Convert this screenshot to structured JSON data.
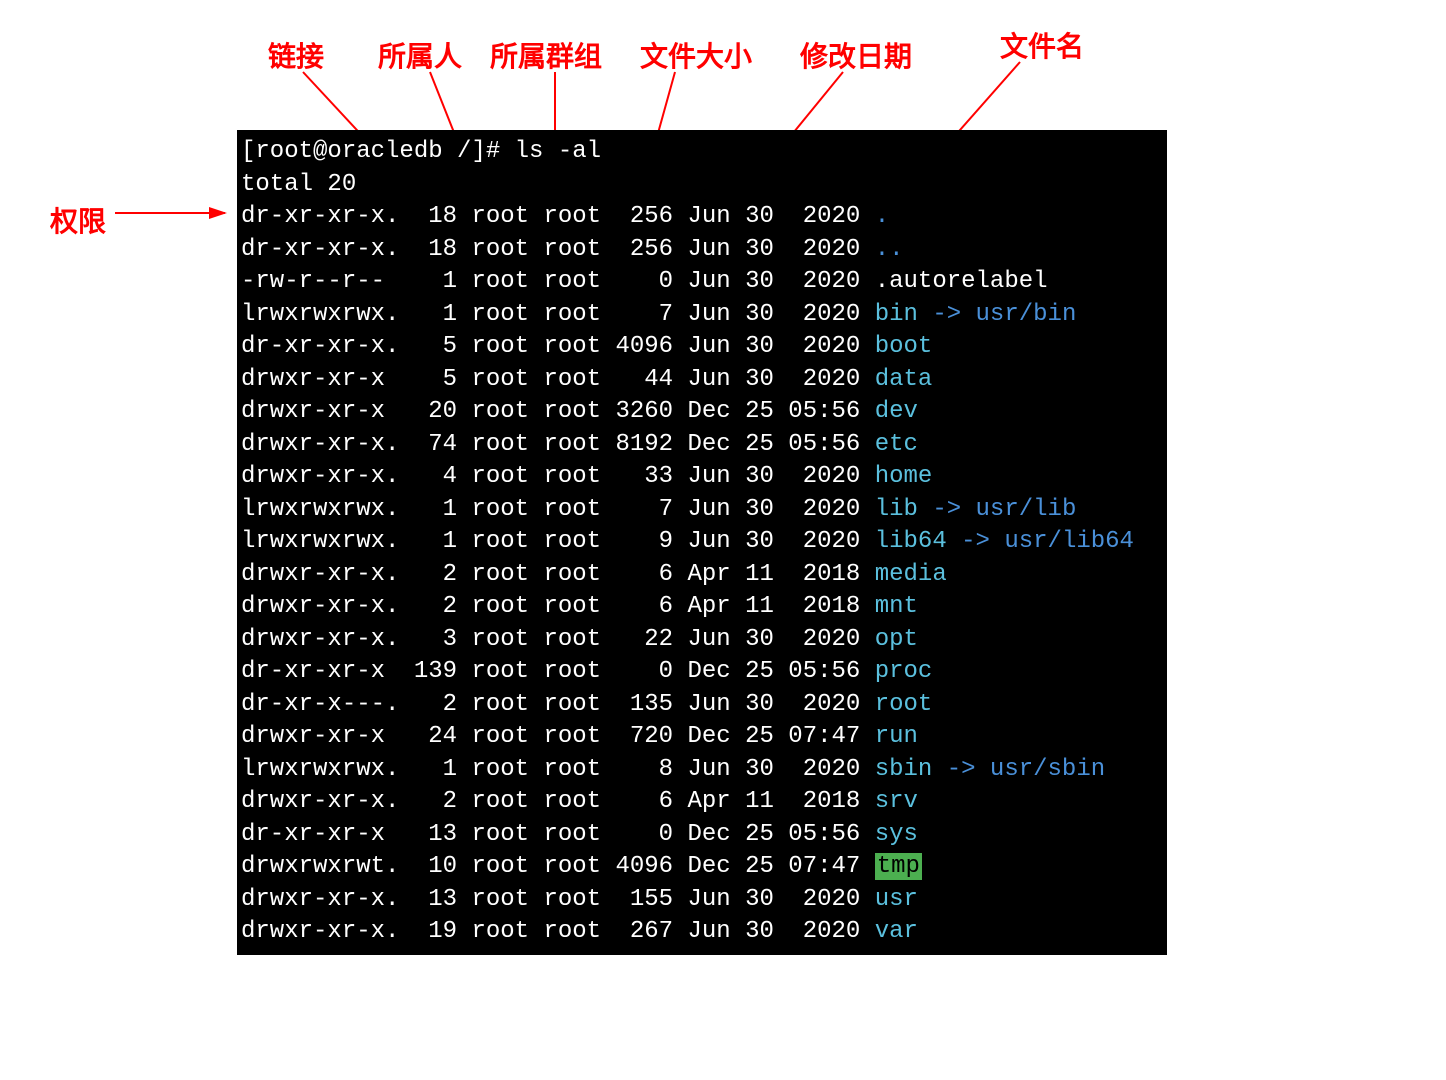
{
  "labels": {
    "perm": "权限",
    "links": "链接",
    "owner": "所属人",
    "group": "所属群组",
    "size": "文件大小",
    "date": "修改日期",
    "name": "文件名"
  },
  "prompt": "[root@oracledb /]# ls -al",
  "total": "total 20",
  "rows": [
    {
      "perm": "dr-xr-xr-x.",
      "links": "18",
      "owner": "root",
      "group": "root",
      "size": "256",
      "month": "Jun",
      "day": "30",
      "time": " 2020",
      "name": ".",
      "cls": "blue",
      "link": ""
    },
    {
      "perm": "dr-xr-xr-x.",
      "links": "18",
      "owner": "root",
      "group": "root",
      "size": "256",
      "month": "Jun",
      "day": "30",
      "time": " 2020",
      "name": "..",
      "cls": "blue",
      "link": ""
    },
    {
      "perm": "-rw-r--r--",
      "links": "1",
      "owner": "root",
      "group": "root",
      "size": "0",
      "month": "Jun",
      "day": "30",
      "time": " 2020",
      "name": ".autorelabel",
      "cls": "",
      "link": ""
    },
    {
      "perm": "lrwxrwxrwx.",
      "links": "1",
      "owner": "root",
      "group": "root",
      "size": "7",
      "month": "Jun",
      "day": "30",
      "time": " 2020",
      "name": "bin",
      "cls": "cyan",
      "link": " -> usr/bin"
    },
    {
      "perm": "dr-xr-xr-x.",
      "links": "5",
      "owner": "root",
      "group": "root",
      "size": "4096",
      "month": "Jun",
      "day": "30",
      "time": " 2020",
      "name": "boot",
      "cls": "cyan",
      "link": ""
    },
    {
      "perm": "drwxr-xr-x",
      "links": "5",
      "owner": "root",
      "group": "root",
      "size": "44",
      "month": "Jun",
      "day": "30",
      "time": " 2020",
      "name": "data",
      "cls": "cyan",
      "link": ""
    },
    {
      "perm": "drwxr-xr-x",
      "links": "20",
      "owner": "root",
      "group": "root",
      "size": "3260",
      "month": "Dec",
      "day": "25",
      "time": "05:56",
      "name": "dev",
      "cls": "cyan",
      "link": ""
    },
    {
      "perm": "drwxr-xr-x.",
      "links": "74",
      "owner": "root",
      "group": "root",
      "size": "8192",
      "month": "Dec",
      "day": "25",
      "time": "05:56",
      "name": "etc",
      "cls": "cyan",
      "link": ""
    },
    {
      "perm": "drwxr-xr-x.",
      "links": "4",
      "owner": "root",
      "group": "root",
      "size": "33",
      "month": "Jun",
      "day": "30",
      "time": " 2020",
      "name": "home",
      "cls": "cyan",
      "link": ""
    },
    {
      "perm": "lrwxrwxrwx.",
      "links": "1",
      "owner": "root",
      "group": "root",
      "size": "7",
      "month": "Jun",
      "day": "30",
      "time": " 2020",
      "name": "lib",
      "cls": "cyan",
      "link": " -> usr/lib"
    },
    {
      "perm": "lrwxrwxrwx.",
      "links": "1",
      "owner": "root",
      "group": "root",
      "size": "9",
      "month": "Jun",
      "day": "30",
      "time": " 2020",
      "name": "lib64",
      "cls": "cyan",
      "link": " -> usr/lib64"
    },
    {
      "perm": "drwxr-xr-x.",
      "links": "2",
      "owner": "root",
      "group": "root",
      "size": "6",
      "month": "Apr",
      "day": "11",
      "time": " 2018",
      "name": "media",
      "cls": "cyan",
      "link": ""
    },
    {
      "perm": "drwxr-xr-x.",
      "links": "2",
      "owner": "root",
      "group": "root",
      "size": "6",
      "month": "Apr",
      "day": "11",
      "time": " 2018",
      "name": "mnt",
      "cls": "cyan",
      "link": ""
    },
    {
      "perm": "drwxr-xr-x.",
      "links": "3",
      "owner": "root",
      "group": "root",
      "size": "22",
      "month": "Jun",
      "day": "30",
      "time": " 2020",
      "name": "opt",
      "cls": "cyan",
      "link": ""
    },
    {
      "perm": "dr-xr-xr-x",
      "links": "139",
      "owner": "root",
      "group": "root",
      "size": "0",
      "month": "Dec",
      "day": "25",
      "time": "05:56",
      "name": "proc",
      "cls": "cyan",
      "link": ""
    },
    {
      "perm": "dr-xr-x---.",
      "links": "2",
      "owner": "root",
      "group": "root",
      "size": "135",
      "month": "Jun",
      "day": "30",
      "time": " 2020",
      "name": "root",
      "cls": "cyan",
      "link": ""
    },
    {
      "perm": "drwxr-xr-x",
      "links": "24",
      "owner": "root",
      "group": "root",
      "size": "720",
      "month": "Dec",
      "day": "25",
      "time": "07:47",
      "name": "run",
      "cls": "cyan",
      "link": ""
    },
    {
      "perm": "lrwxrwxrwx.",
      "links": "1",
      "owner": "root",
      "group": "root",
      "size": "8",
      "month": "Jun",
      "day": "30",
      "time": " 2020",
      "name": "sbin",
      "cls": "cyan",
      "link": " -> usr/sbin"
    },
    {
      "perm": "drwxr-xr-x.",
      "links": "2",
      "owner": "root",
      "group": "root",
      "size": "6",
      "month": "Apr",
      "day": "11",
      "time": " 2018",
      "name": "srv",
      "cls": "cyan",
      "link": ""
    },
    {
      "perm": "dr-xr-xr-x",
      "links": "13",
      "owner": "root",
      "group": "root",
      "size": "0",
      "month": "Dec",
      "day": "25",
      "time": "05:56",
      "name": "sys",
      "cls": "cyan",
      "link": ""
    },
    {
      "perm": "drwxrwxrwt.",
      "links": "10",
      "owner": "root",
      "group": "root",
      "size": "4096",
      "month": "Dec",
      "day": "25",
      "time": "07:47",
      "name": "tmp",
      "cls": "tmp-bg",
      "link": ""
    },
    {
      "perm": "drwxr-xr-x.",
      "links": "13",
      "owner": "root",
      "group": "root",
      "size": "155",
      "month": "Jun",
      "day": "30",
      "time": " 2020",
      "name": "usr",
      "cls": "cyan",
      "link": ""
    },
    {
      "perm": "drwxr-xr-x.",
      "links": "19",
      "owner": "root",
      "group": "root",
      "size": "267",
      "month": "Jun",
      "day": "30",
      "time": " 2020",
      "name": "var",
      "cls": "cyan",
      "link": ""
    }
  ]
}
